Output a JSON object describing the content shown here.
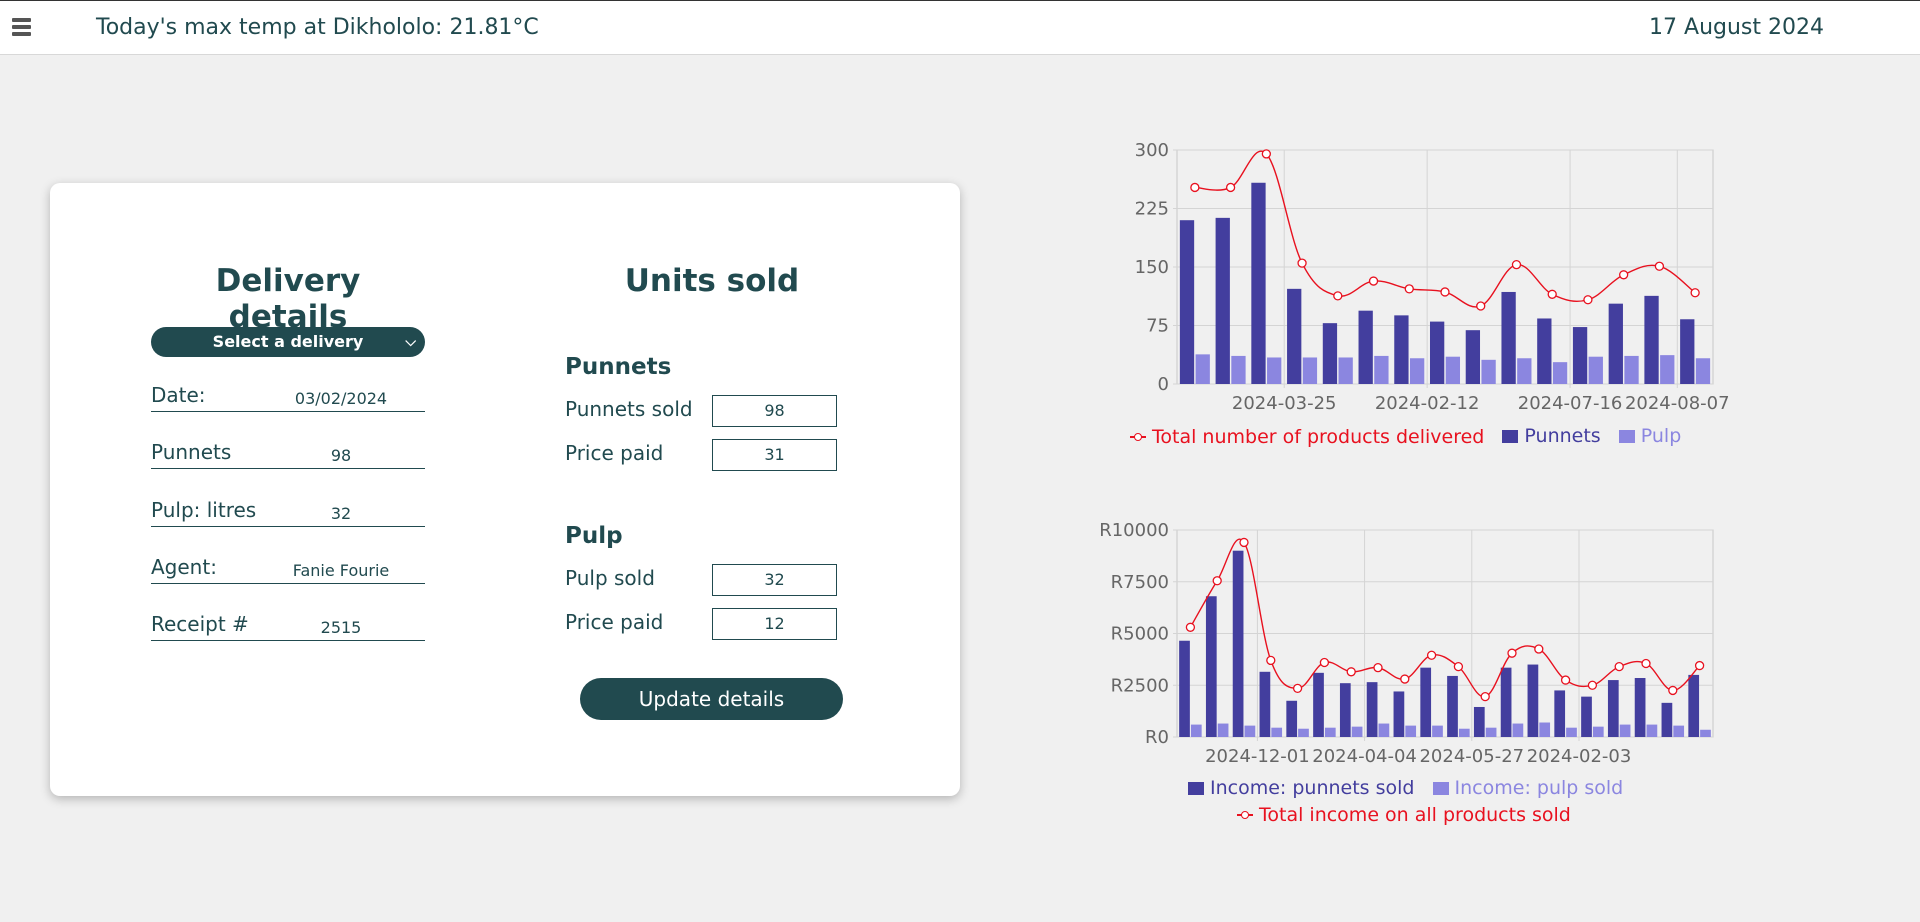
{
  "header": {
    "temp_text": "Today's max temp at Dikhololo: 21.81°C",
    "date_text": "17 August 2024"
  },
  "delivery": {
    "heading": "Delivery details",
    "select_label": "Select a delivery",
    "fields": [
      {
        "label": "Date:",
        "value": "03/02/2024"
      },
      {
        "label": "Punnets",
        "value": "98"
      },
      {
        "label": "Pulp: litres",
        "value": "32"
      },
      {
        "label": "Agent:",
        "value": "Fanie Fourie"
      },
      {
        "label": "Receipt #",
        "value": "2515"
      }
    ]
  },
  "units": {
    "heading": "Units sold",
    "punnets_heading": "Punnets",
    "punnets_sold_label": "Punnets sold",
    "punnets_sold_value": "98",
    "punnets_price_label": "Price paid",
    "punnets_price_value": "31",
    "pulp_heading": "Pulp",
    "pulp_sold_label": "Pulp sold",
    "pulp_sold_value": "32",
    "pulp_price_label": "Price paid",
    "pulp_price_value": "12",
    "update_label": "Update details"
  },
  "colors": {
    "primary": "#214a4f",
    "punnets_bar": "#433e9e",
    "pulp_bar": "#8b86e0",
    "total_line": "#e8111f",
    "background": "#f0f0f0"
  },
  "chart_data": [
    {
      "type": "bar",
      "title": "",
      "ylim": [
        0,
        300
      ],
      "yticks": [
        "0",
        "75",
        "150",
        "225",
        "300"
      ],
      "ytick_values": [
        0,
        75,
        150,
        225,
        300
      ],
      "xtick_labels": [
        "2024-03-25",
        "2024-02-12",
        "2024-07-16",
        "2024-08-07"
      ],
      "xtick_indices": [
        2.5,
        6.5,
        10.5,
        13.5
      ],
      "grid": true,
      "legend_position": "bottom",
      "series": [
        {
          "name": "Total number of products delivered",
          "kind": "line",
          "color": "#e8111f",
          "values": [
            252,
            252,
            295,
            155,
            113,
            132,
            122,
            118,
            100,
            153,
            115,
            108,
            140,
            151,
            117
          ]
        },
        {
          "name": "Punnets",
          "kind": "bar",
          "color": "#433e9e",
          "values": [
            210,
            213,
            258,
            122,
            78,
            94,
            88,
            80,
            69,
            118,
            84,
            73,
            103,
            113,
            83
          ]
        },
        {
          "name": "Pulp",
          "kind": "bar",
          "color": "#8b86e0",
          "values": [
            38,
            36,
            34,
            34,
            34,
            36,
            33,
            35,
            31,
            33,
            28,
            35,
            36,
            37,
            33
          ]
        }
      ]
    },
    {
      "type": "bar",
      "title": "",
      "ylim": [
        0,
        10000
      ],
      "yticks": [
        "R0",
        "R2500",
        "R5000",
        "R7500",
        "R10000"
      ],
      "ytick_values": [
        0,
        2500,
        5000,
        7500,
        10000
      ],
      "xtick_labels": [
        "2024-12-01",
        "2024-04-04",
        "2024-05-27",
        "2024-02-03"
      ],
      "xtick_indices": [
        2.5,
        6.5,
        10.5,
        14.5
      ],
      "grid": true,
      "legend_position": "bottom",
      "series": [
        {
          "name": "Income: punnets sold",
          "kind": "bar",
          "color": "#433e9e",
          "values": [
            4650,
            6800,
            9000,
            3150,
            1750,
            3100,
            2600,
            2650,
            2200,
            3350,
            2950,
            1450,
            3350,
            3500,
            2250,
            1950,
            2750,
            2850,
            1650,
            3000
          ]
        },
        {
          "name": "Income: pulp sold",
          "kind": "bar",
          "color": "#8b86e0",
          "values": [
            600,
            650,
            550,
            450,
            400,
            450,
            500,
            650,
            550,
            550,
            400,
            450,
            650,
            700,
            450,
            500,
            600,
            600,
            550,
            350
          ]
        },
        {
          "name": "Total income on all products sold",
          "kind": "line",
          "color": "#e8111f",
          "values": [
            5300,
            7550,
            9400,
            3700,
            2350,
            3600,
            3150,
            3350,
            2800,
            3950,
            3400,
            1950,
            4050,
            4250,
            2750,
            2500,
            3400,
            3550,
            2250,
            3450
          ]
        }
      ]
    }
  ]
}
